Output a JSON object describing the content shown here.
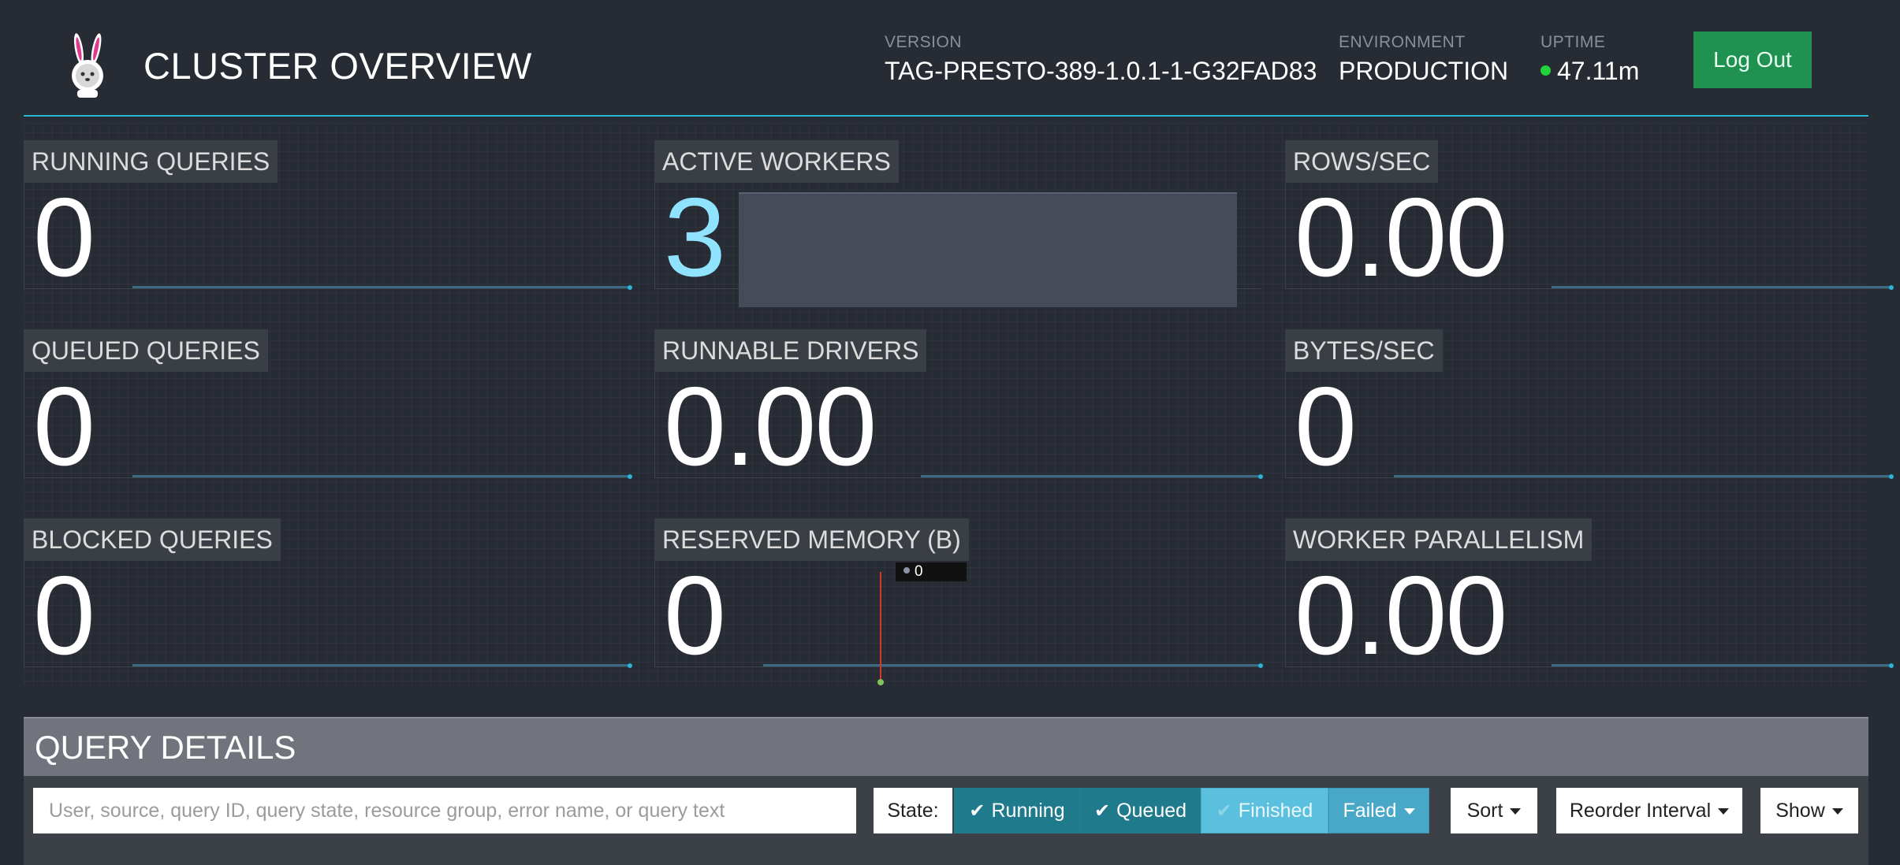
{
  "header": {
    "title": "CLUSTER OVERVIEW",
    "version_label": "VERSION",
    "version_value": "TAG-PRESTO-389-1.0.1-1-G32FAD83",
    "environment_label": "ENVIRONMENT",
    "environment_value": "PRODUCTION",
    "uptime_label": "UPTIME",
    "uptime_value": "47.11m",
    "logout_label": "Log Out",
    "logo_icon": "bunny-logo-icon"
  },
  "stats": {
    "running_queries": {
      "label": "RUNNING QUERIES",
      "value": "0"
    },
    "active_workers": {
      "label": "ACTIVE WORKERS",
      "value": "3"
    },
    "rows_sec": {
      "label": "ROWS/SEC",
      "value": "0.00"
    },
    "queued_queries": {
      "label": "QUEUED QUERIES",
      "value": "0"
    },
    "runnable_drivers": {
      "label": "RUNNABLE DRIVERS",
      "value": "0.00"
    },
    "bytes_sec": {
      "label": "BYTES/SEC",
      "value": "0"
    },
    "blocked_queries": {
      "label": "BLOCKED QUERIES",
      "value": "0"
    },
    "reserved_memory": {
      "label": "RESERVED MEMORY (B)",
      "value": "0",
      "tooltip_value": "0"
    },
    "worker_parallelism": {
      "label": "WORKER PARALLELISM",
      "value": "0.00"
    }
  },
  "query_details": {
    "title": "QUERY DETAILS",
    "search_placeholder": "User, source, query ID, query state, resource group, error name, or query text",
    "state_label": "State:",
    "state_buttons": [
      {
        "label": "Running",
        "checked": true,
        "color": "#1f7a8c"
      },
      {
        "label": "Queued",
        "checked": true,
        "color": "#1f7a8c"
      },
      {
        "label": "Finished",
        "checked": false,
        "color": "#5bc0de"
      },
      {
        "label": "Failed",
        "checked": false,
        "color": "#49a8c8"
      }
    ],
    "sort_label": "Sort",
    "reorder_label": "Reorder Interval",
    "show_label": "Show"
  },
  "colors": {
    "accent": "#2ab4d6",
    "logout": "#1f9151",
    "uptime_dot": "#22d33b",
    "workers_value": "#8fe3ff"
  }
}
